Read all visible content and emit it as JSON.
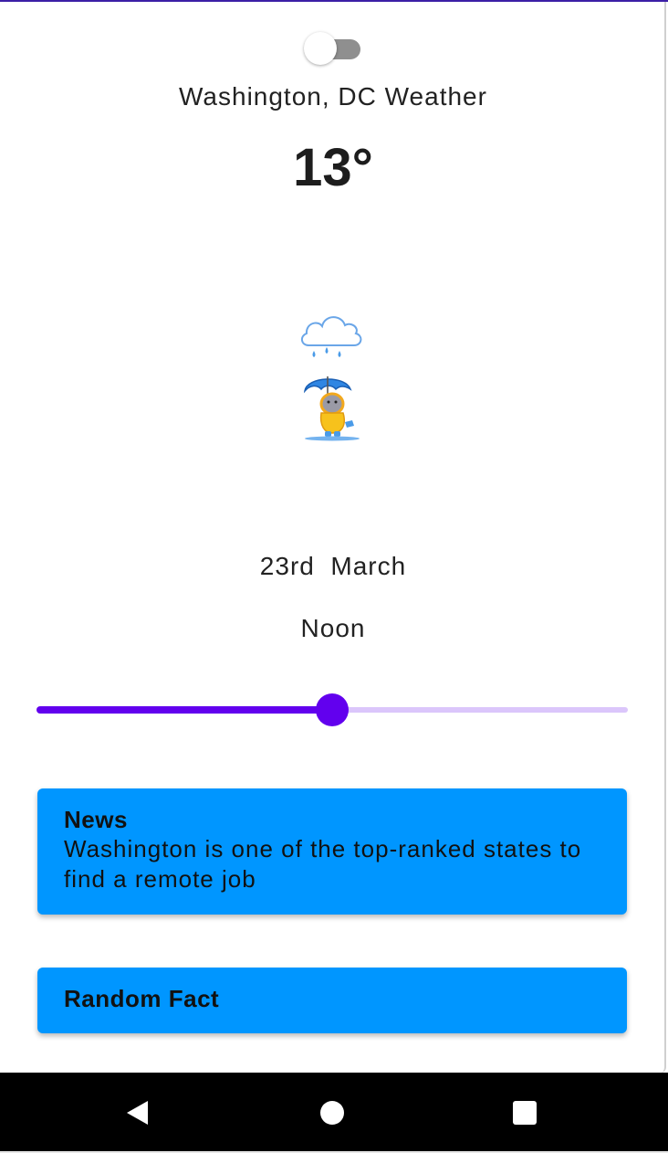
{
  "header": {
    "city_title": "Washington, DC Weather",
    "temperature": "13°"
  },
  "toggle": {
    "on": false
  },
  "weather": {
    "icon": "rain-cloud-umbrella-cat-icon"
  },
  "date": {
    "date_text": "23rd  March",
    "time_text": "Noon"
  },
  "slider": {
    "value": 0.5
  },
  "cards": {
    "news": {
      "title": "News",
      "body": "Washington is one of the top-ranked states to find a remote job"
    },
    "fact": {
      "title": "Random Fact"
    }
  },
  "colors": {
    "accent": "#6200ee",
    "accent_light": "#dbc6fb",
    "card_blue": "#0096ff",
    "nav_bar": "#000000"
  },
  "navbar": {
    "back_icon": "back-triangle-icon",
    "home_icon": "home-circle-icon",
    "recents_icon": "recents-square-icon"
  }
}
